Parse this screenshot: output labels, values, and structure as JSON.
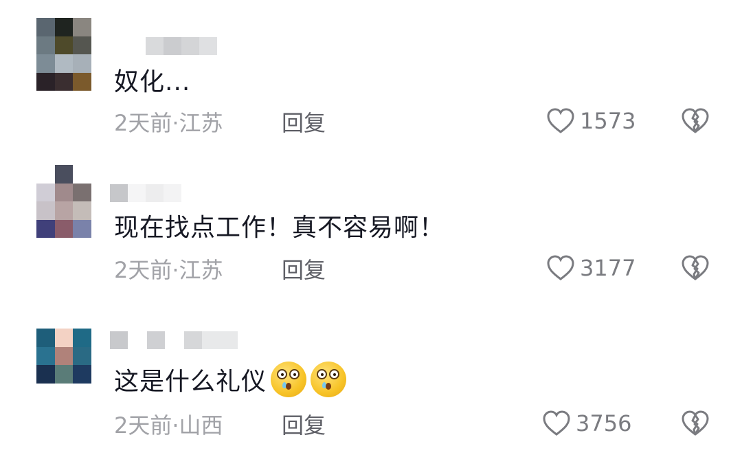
{
  "comments": [
    {
      "text": "奴化...",
      "time": "2天前",
      "separator": "·",
      "location": "江苏",
      "reply_label": "回复",
      "likes": "1573",
      "avatar_colors": [
        "#5a6670",
        "#1f2420",
        "#8a8680",
        "#6c7a82",
        "#4e4a2a",
        "#555650",
        "#7d8c96",
        "#b0bac2",
        "#a7b0b8",
        "#2a2228",
        "#3a2e30",
        "#7b5a2c"
      ],
      "username_colors": [
        "#d9dadc",
        "#cbcccf",
        "#d4d5d7",
        "#dfe0e2"
      ]
    },
    {
      "text": "现在找点工作！真不容易啊！",
      "time": "2天前",
      "separator": "·",
      "location": "江苏",
      "reply_label": "回复",
      "likes": "3177",
      "avatar_colors": [
        "#ffffff",
        "#4a4e5e",
        "#ffffff",
        "#d0cdd6",
        "#a08a8c",
        "#7a7070",
        "#c8c2c8",
        "#b8a4a4",
        "#c4bcb8",
        "#40407a",
        "#8a5c6a",
        "#7a82aa"
      ],
      "username_colors": [
        "#c6c7ca",
        "#f5f5f6",
        "#ededee",
        "#f3f3f4"
      ]
    },
    {
      "text": "这是什么礼仪",
      "time": "2天前",
      "separator": "·",
      "location": "山西",
      "reply_label": "回复",
      "likes": "3756",
      "avatar_colors": [
        "#1e5e7a",
        "#f3d2c4",
        "#1f6a86",
        "#2a7290",
        "#b0827a",
        "#2a6a84",
        "#1a3050",
        "#5a7c78",
        "#1e3a60",
        "#ffffff",
        "#ffffff",
        "#ffffff"
      ],
      "username_colors": [
        "#c8c9cc",
        "#cfd0d3",
        "#d6d7d9",
        "#e8e9ea"
      ]
    }
  ],
  "icons": {
    "like": "heart-outline-icon",
    "dislike": "broken-heart-icon",
    "emoji": "drooling-face-emoji-icon"
  },
  "colors": {
    "text": "#161823",
    "meta": "#a1a2a7",
    "reply": "#5e5f66",
    "icon": "#7a7b80"
  }
}
